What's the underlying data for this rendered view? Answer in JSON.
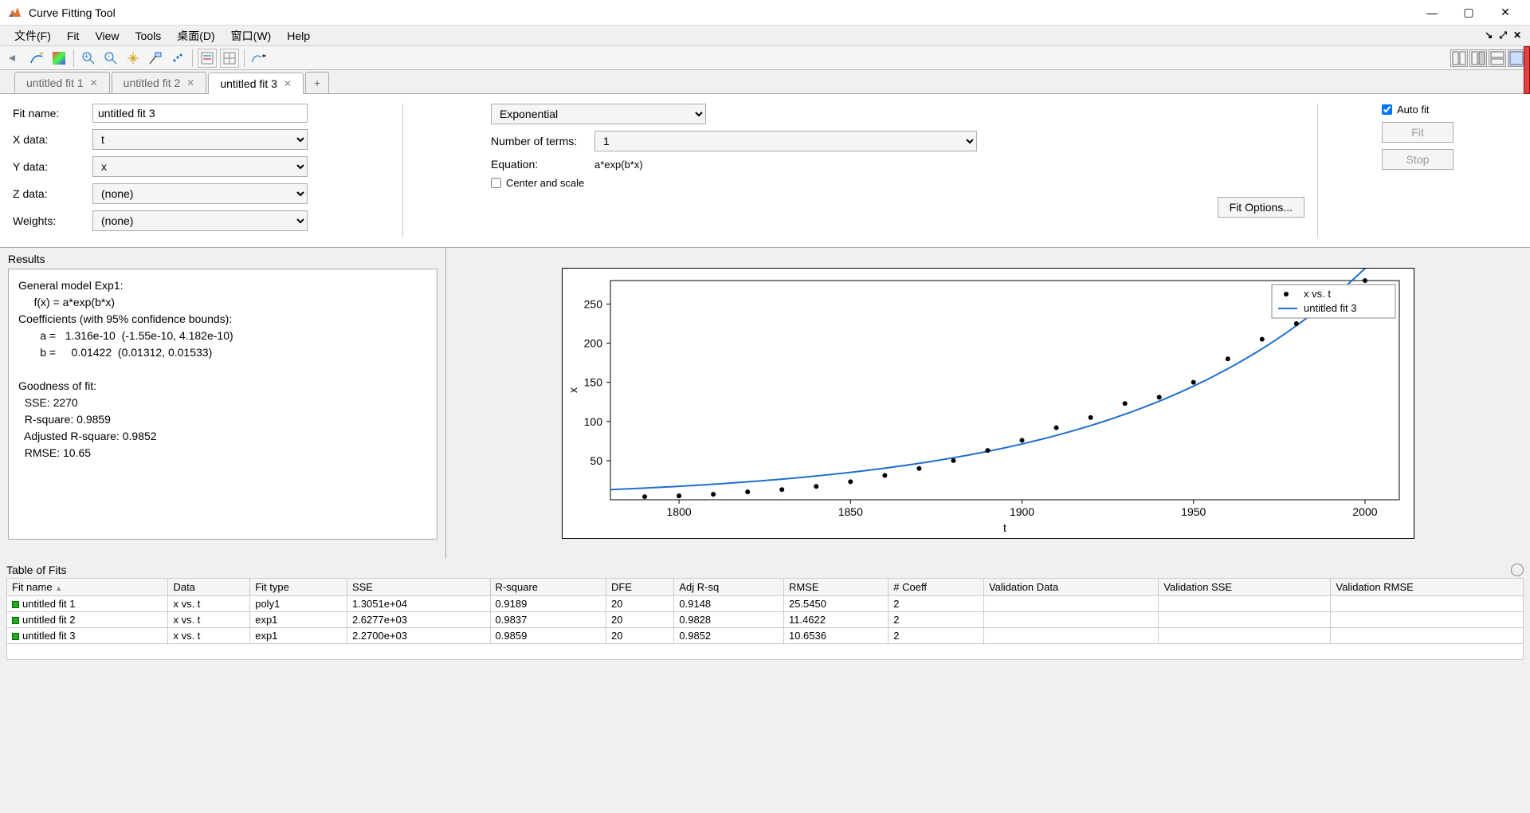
{
  "window": {
    "title": "Curve Fitting Tool"
  },
  "menu": {
    "file": "文件(F)",
    "fit": "Fit",
    "view": "View",
    "tools": "Tools",
    "desktop": "桌面(D)",
    "window": "窗口(W)",
    "help": "Help"
  },
  "tabs": {
    "t1": "untitled fit 1",
    "t2": "untitled fit 2",
    "t3": "untitled fit 3"
  },
  "form": {
    "fitname_lbl": "Fit name:",
    "fitname_val": "untitled fit 3",
    "xdata_lbl": "X data:",
    "xdata_val": "t",
    "ydata_lbl": "Y data:",
    "ydata_val": "x",
    "zdata_lbl": "Z data:",
    "zdata_val": "(none)",
    "weights_lbl": "Weights:",
    "weights_val": "(none)"
  },
  "mid": {
    "fittype": "Exponential",
    "nterms_lbl": "Number of terms:",
    "nterms_val": "1",
    "eqn_lbl": "Equation:",
    "eqn_val": "a*exp(b*x)",
    "center_lbl": "Center and scale",
    "fitopts": "Fit Options..."
  },
  "right": {
    "autofit": "Auto fit",
    "fit": "Fit",
    "stop": "Stop"
  },
  "results": {
    "heading": "Results",
    "text": "General model Exp1:\n     f(x) = a*exp(b*x)\nCoefficients (with 95% confidence bounds):\n       a =   1.316e-10  (-1.55e-10, 4.182e-10)\n       b =     0.01422  (0.01312, 0.01533)\n\nGoodness of fit:\n  SSE: 2270\n  R-square: 0.9859\n  Adjusted R-square: 0.9852\n  RMSE: 10.65"
  },
  "chart_data": {
    "type": "scatter+line",
    "xlabel": "t",
    "ylabel": "x",
    "xlim": [
      1780,
      2010
    ],
    "ylim": [
      0,
      280
    ],
    "xticks": [
      1800,
      1850,
      1900,
      1950,
      2000
    ],
    "yticks": [
      50,
      100,
      150,
      200,
      250
    ],
    "legend": {
      "position": "top-right",
      "entries": [
        {
          "marker": "dot",
          "label": "x vs. t"
        },
        {
          "marker": "line",
          "color": "#1f6fd0",
          "label": "untitled fit 3"
        }
      ]
    },
    "series": [
      {
        "name": "x vs. t",
        "type": "scatter",
        "x": [
          1790,
          1800,
          1810,
          1820,
          1830,
          1840,
          1850,
          1860,
          1870,
          1880,
          1890,
          1900,
          1910,
          1920,
          1930,
          1940,
          1950,
          1960,
          1970,
          1980,
          1990,
          2000
        ],
        "y": [
          4,
          5,
          7,
          10,
          13,
          17,
          23,
          31,
          40,
          50,
          63,
          76,
          92,
          105,
          123,
          131,
          150,
          180,
          205,
          225,
          250,
          280
        ]
      },
      {
        "name": "untitled fit 3",
        "type": "line",
        "color": "#1f6fd0",
        "a": 1.316e-10,
        "b": 0.01422
      }
    ]
  },
  "tof": {
    "heading": "Table of Fits",
    "headers": [
      "Fit name",
      "Data",
      "Fit type",
      "SSE",
      "R-square",
      "DFE",
      "Adj R-sq",
      "RMSE",
      "# Coeff",
      "Validation Data",
      "Validation SSE",
      "Validation RMSE"
    ],
    "rows": [
      {
        "name": "untitled fit 1",
        "data": "x vs. t",
        "type": "poly1",
        "sse": "1.3051e+04",
        "rsq": "0.9189",
        "dfe": "20",
        "adj": "0.9148",
        "rmse": "25.5450",
        "ncoeff": "2",
        "vd": "",
        "vsse": "",
        "vrmse": ""
      },
      {
        "name": "untitled fit 2",
        "data": "x vs. t",
        "type": "exp1",
        "sse": "2.6277e+03",
        "rsq": "0.9837",
        "dfe": "20",
        "adj": "0.9828",
        "rmse": "11.4622",
        "ncoeff": "2",
        "vd": "",
        "vsse": "",
        "vrmse": ""
      },
      {
        "name": "untitled fit 3",
        "data": "x vs. t",
        "type": "exp1",
        "sse": "2.2700e+03",
        "rsq": "0.9859",
        "dfe": "20",
        "adj": "0.9852",
        "rmse": "10.6536",
        "ncoeff": "2",
        "vd": "",
        "vsse": "",
        "vrmse": ""
      }
    ]
  }
}
